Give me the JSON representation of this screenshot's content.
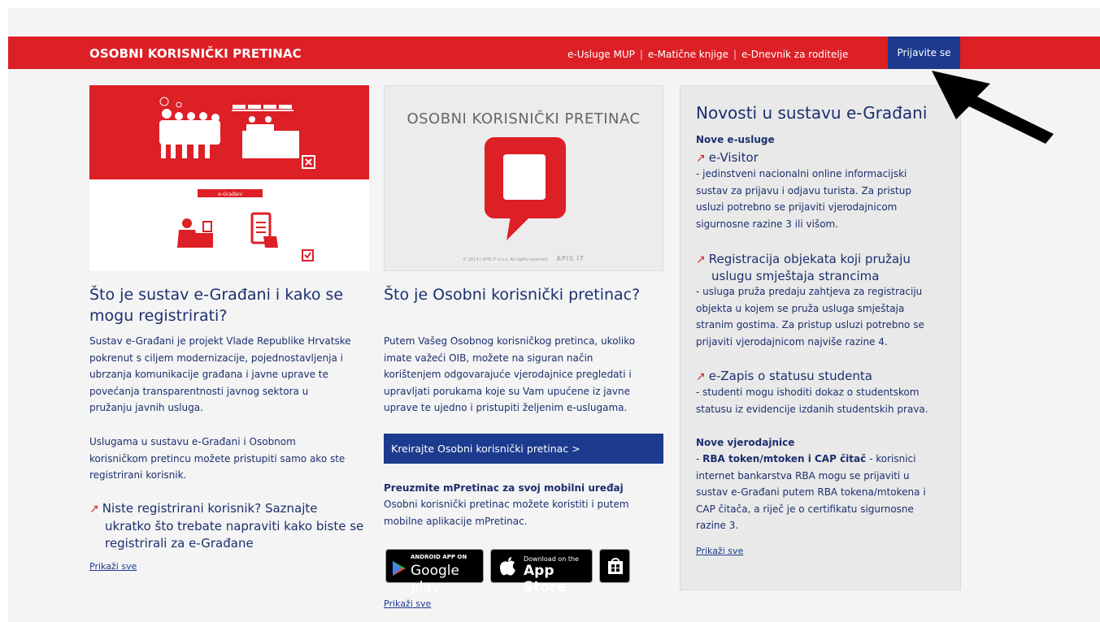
{
  "header": {
    "brand": "OSOBNI KORISNIČKI PRETINAC",
    "nav": [
      "e-Usluge MUP",
      "e-Matične knjige",
      "e-Dnevnik za roditelje"
    ],
    "login": "Prijavite se"
  },
  "col1": {
    "image_header": "e-Građani",
    "title_line1": "Što je sustav e-Građani i kako se",
    "title_line2": "mogu registrirati?",
    "para1": [
      "Sustav e-Građani je projekt Vlade Republike Hrvatske",
      "pokrenut s ciljem modernizacije, pojednostavljenja i",
      "ubrzanja komunikacije građana i javne uprave te",
      "povećanja transparentnosti javnog sektora u",
      "pružanju javnih usluga."
    ],
    "para2": [
      "Uslugama u sustavu e-Građani i Osobnom",
      "korisničkom pretincu možete pristupiti samo ako ste",
      "registrirani korisnik."
    ],
    "ext_link": [
      "Niste registrirani korisnik? Saznajte",
      "ukratko što trebate napraviti kako biste se",
      "registrirali za e-Građane"
    ],
    "more": "Prikaži sve"
  },
  "col2": {
    "image_title": "OSOBNI KORISNIČKI PRETINAC",
    "image_footer": "© 2014 | APIS IT d.o.o. All rights reserved.",
    "image_logo": "APIS IT",
    "title": "Što je Osobni korisnički pretinac?",
    "para": [
      "Putem Vašeg Osobnog korisničkog pretinca, ukoliko",
      "imate važeći OIB, možete na siguran način",
      "korištenjem odgovarajuće vjerodajnice pregledati i",
      "upravljati porukama koje su Vam upućene iz javne",
      "uprave te ujedno i pristupiti željenim e-uslugama."
    ],
    "cta": "Kreirajte Osobni korisnički pretinac >",
    "mobile_title": "Preuzmite mPretinac za svoj mobilni uređaj",
    "mobile_para": [
      "Osobni korisnički pretinac možete koristiti i putem",
      "mobilne aplikacije mPretinac."
    ],
    "google_small": "ANDROID APP ON",
    "google_big": "Google play",
    "apple_small": "Download on the",
    "apple_big": "App Store",
    "more": "Prikaži sve"
  },
  "news": {
    "title": "Novosti u sustavu e-Građani",
    "sub1": "Nove e-usluge",
    "item1_title": "e-Visitor",
    "item1_para": [
      "- jedinstveni nacionalni online informacijski",
      "sustav za prijavu i odjavu turista. Za pristup",
      "usluzi potrebno se prijaviti vjerodajnicom",
      "sigurnosne razine 3 ili višom."
    ],
    "item2_title": [
      "Registracija objekata koji pružaju",
      "uslugu smještaja strancima"
    ],
    "item2_para": [
      "- usluga pruža predaju zahtjeva za registraciju",
      "objekta u kojem se pruža usluga smještaja",
      "stranim gostima. Za pristup usluzi potrebno se",
      "prijaviti vjerodajnicom najviše razine 4."
    ],
    "item3_title": "e-Zapis o statusu studenta",
    "item3_para": [
      "- studenti mogu ishoditi dokaz o studentskom",
      "statusu iz evidencije izdanih studentskih prava."
    ],
    "sub2": "Nove vjerodajnice",
    "cred_bold": "RBA token/mtoken i CAP čitač",
    "cred_line1_prefix": "- ",
    "cred_line1_suffix": " - korisnici",
    "cred_lines": [
      "internet bankarstva RBA mogu se prijaviti u",
      "sustav e-Građani putem RBA tokena/mtokena i",
      "CAP čitača, a riječ je o certifikatu sigurnosne",
      "razine 3."
    ],
    "more": "Prikaži sve"
  },
  "colors": {
    "red": "#dd1f26",
    "navy": "#1c3a8e",
    "text": "#1c2f6e"
  },
  "icons": [
    "external-link-icon",
    "speech-bubble-icon",
    "google-play-icon",
    "apple-icon",
    "windows-store-icon",
    "arrow-pointer-icon"
  ]
}
